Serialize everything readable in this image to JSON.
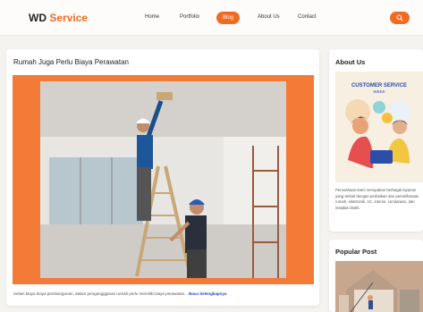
{
  "header": {
    "logo": {
      "prefix": "WD",
      "accent": "Service"
    },
    "nav": [
      "Home",
      "Portfolio",
      "Blog",
      "About Us",
      "Contact"
    ],
    "active_nav": "Blog",
    "search_icon": "search-icon"
  },
  "post": {
    "title": "Rumah Juga Perlu Biaya Perawatan",
    "excerpt": "Selain biaya biaya pembangunan, dalam pengangggaran rumah perlu memiliki biaya perawatan...",
    "read_more": "Baca Selengkapnya"
  },
  "sidebar": {
    "about_title": "About Us",
    "about_banner": {
      "line1": "CUSTOMER SERVICE",
      "line2": "WEEK"
    },
    "about_text": "Perusahaan kami merupakan berbagai layanan yang terkait dengan perbaikan dan pemeliharaan rumah, elektronik, AC, interior, cendaraan, dan instalasi listrik.",
    "popular_title": "Popular Post"
  },
  "colors": {
    "accent": "#f26a21",
    "link": "#2546c2"
  }
}
